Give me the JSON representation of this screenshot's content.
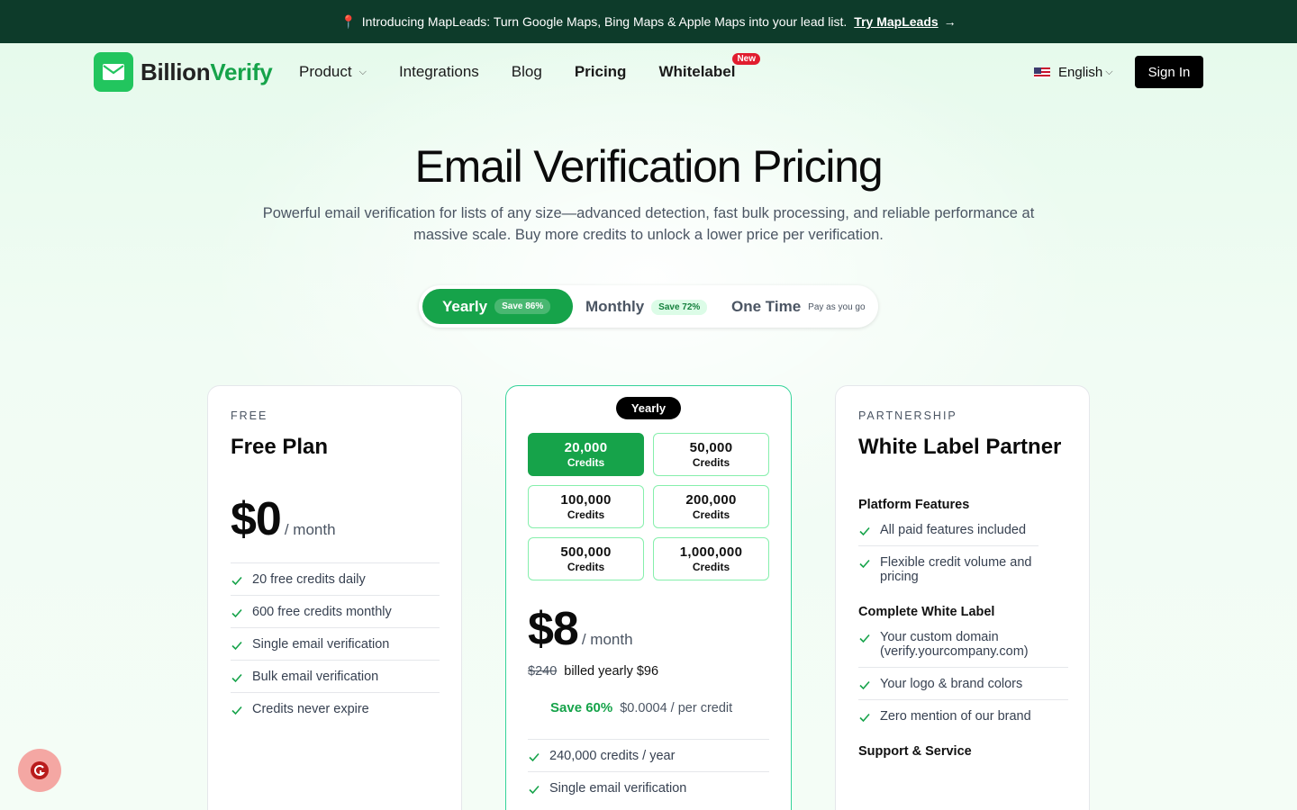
{
  "banner": {
    "text": "Introducing MapLeads: Turn Google Maps, Bing Maps & Apple Maps into your lead list.",
    "cta": "Try MapLeads"
  },
  "nav": {
    "logo_part1": "Billion",
    "logo_part2": "Verify",
    "items": [
      {
        "label": "Product"
      },
      {
        "label": "Integrations"
      },
      {
        "label": "Blog"
      },
      {
        "label": "Pricing"
      },
      {
        "label": "Whitelabel"
      }
    ],
    "new_badge": "New",
    "language": "English",
    "signin": "Sign In"
  },
  "hero": {
    "title": "Email Verification Pricing",
    "subtitle": "Powerful email verification for lists of any size—advanced detection, fast bulk processing, and reliable performance at massive scale. Buy more credits to unlock a lower price per verification."
  },
  "billing_toggle": {
    "yearly": {
      "label": "Yearly",
      "badge": "Save 86%"
    },
    "monthly": {
      "label": "Monthly",
      "badge": "Save 72%"
    },
    "one_time": {
      "label": "One Time",
      "note": "Pay as you go"
    },
    "selected": "Yearly"
  },
  "free_plan": {
    "eyebrow": "FREE",
    "title": "Free Plan",
    "price": "$0",
    "period": "/ month",
    "features": [
      "20 free credits daily",
      "600 free credits monthly",
      "Single email verification",
      "Bulk email verification",
      "Credits never expire"
    ]
  },
  "paid_plan": {
    "badge": "Yearly",
    "credit_options": [
      {
        "amount": "20,000",
        "unit": "Credits",
        "selected": true
      },
      {
        "amount": "50,000",
        "unit": "Credits",
        "selected": false
      },
      {
        "amount": "100,000",
        "unit": "Credits",
        "selected": false
      },
      {
        "amount": "200,000",
        "unit": "Credits",
        "selected": false
      },
      {
        "amount": "500,000",
        "unit": "Credits",
        "selected": false
      },
      {
        "amount": "1,000,000",
        "unit": "Credits",
        "selected": false
      }
    ],
    "price": "$8",
    "period": "/ month",
    "original_price": "$240",
    "billed_text": "billed yearly $96",
    "save_text": "Save 60%",
    "per_credit": "$0.0004 / per credit",
    "features": [
      "240,000 credits / year",
      "Single email verification"
    ]
  },
  "partner_plan": {
    "eyebrow": "PARTNERSHIP",
    "title": "White Label Partner",
    "groups": [
      {
        "heading": "Platform Features",
        "items": [
          "All paid features included",
          "Flexible credit volume and pricing"
        ]
      },
      {
        "heading": "Complete White Label",
        "items": [
          "Your custom domain (verify.yourcompany.com)",
          "Your logo & brand colors",
          "Zero mention of our brand"
        ]
      },
      {
        "heading": "Support & Service",
        "items": []
      }
    ]
  },
  "colors": {
    "banner_bg": "#0d3b2a",
    "accent": "#16a34a",
    "brand_green": "#22c55e",
    "new_badge": "#e11d2e"
  }
}
